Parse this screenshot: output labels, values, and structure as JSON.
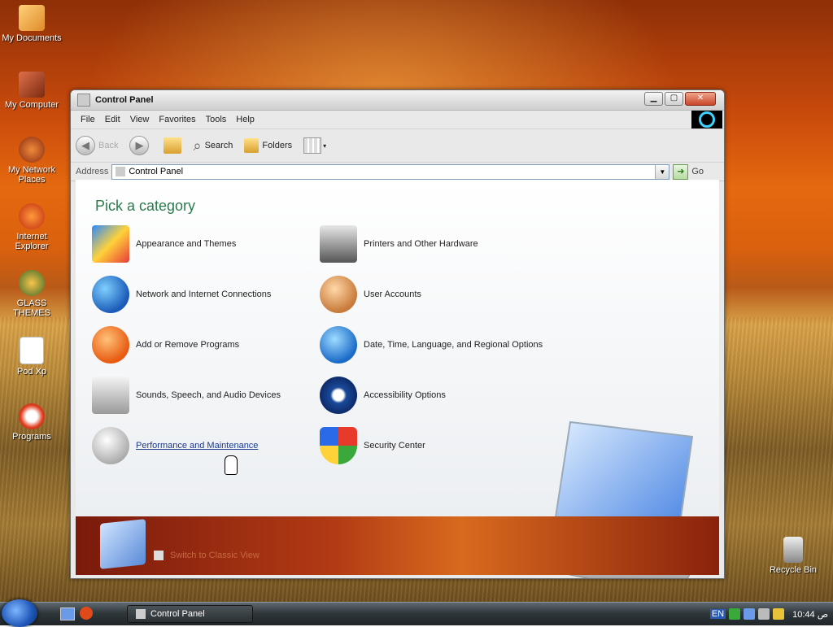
{
  "desktop": {
    "icons": [
      {
        "label": "My Documents"
      },
      {
        "label": "My Computer"
      },
      {
        "label": "My Network Places"
      },
      {
        "label": "Internet Explorer"
      },
      {
        "label": "GLASS THEMES"
      },
      {
        "label": "Pod Xp"
      },
      {
        "label": "Programs"
      },
      {
        "label": "Recycle Bin"
      }
    ]
  },
  "window": {
    "title": "Control Panel",
    "menu": [
      "File",
      "Edit",
      "View",
      "Favorites",
      "Tools",
      "Help"
    ],
    "toolbar": {
      "back": "Back",
      "search": "Search",
      "folders": "Folders"
    },
    "address": {
      "label": "Address",
      "value": "Control Panel",
      "go": "Go"
    },
    "heading": "Pick a category",
    "categories": [
      {
        "label": "Appearance and Themes"
      },
      {
        "label": "Network and Internet Connections"
      },
      {
        "label": "Add or Remove Programs"
      },
      {
        "label": "Sounds, Speech, and Audio Devices"
      },
      {
        "label": "Performance and Maintenance"
      },
      {
        "label": "Printers and Other Hardware"
      },
      {
        "label": "User Accounts"
      },
      {
        "label": "Date, Time, Language, and Regional Options"
      },
      {
        "label": "Accessibility Options"
      },
      {
        "label": "Security Center"
      }
    ],
    "switch_view": "Switch to Classic View"
  },
  "taskbar": {
    "task": "Control Panel",
    "lang": "EN",
    "clock": "10:44 ص"
  },
  "colors": {
    "heading": "#2b7a4b",
    "accent": "#1e56b8"
  }
}
